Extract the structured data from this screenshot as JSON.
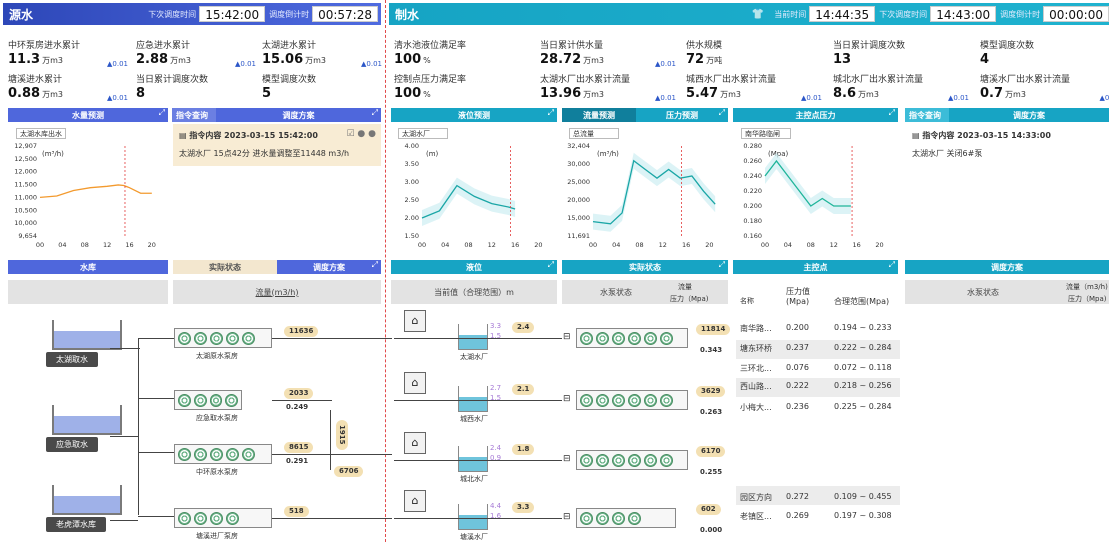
{
  "left_header": {
    "title": "源水",
    "next_label": "下次调度时间",
    "next_value": "15:42:00",
    "countdown_label": "调度倒计时",
    "countdown_value": "00:57:28"
  },
  "right_header": {
    "title": "制水",
    "current_label": "当前时间",
    "current_value": "14:44:35",
    "next_label": "下次调度时间",
    "next_value": "14:43:00",
    "countdown_label": "调度倒计时",
    "countdown_value": "00:00:00"
  },
  "left_stats": [
    {
      "label": "中环泵房进水累计",
      "value": "11.3",
      "unit": "万m3",
      "delta": "▲0.01"
    },
    {
      "label": "应急进水累计",
      "value": "2.88",
      "unit": "万m3",
      "delta": "▲0.01"
    },
    {
      "label": "太湖进水累计",
      "value": "15.06",
      "unit": "万m3",
      "delta": "▲0.01"
    },
    {
      "label": "塘溪进水累计",
      "value": "0.88",
      "unit": "万m3",
      "delta": "▲0.01"
    },
    {
      "label": "当日累计调度次数",
      "value": "8",
      "unit": "",
      "delta": ""
    },
    {
      "label": "模型调度次数",
      "value": "5",
      "unit": "",
      "delta": ""
    }
  ],
  "right_stats": [
    {
      "label": "清水池液位满足率",
      "value": "100",
      "unit": "%",
      "delta": ""
    },
    {
      "label": "当日累计供水量",
      "value": "28.72",
      "unit": "万m3",
      "delta": "▲0.01"
    },
    {
      "label": "供水规模",
      "value": "72",
      "unit": "万吨",
      "delta": ""
    },
    {
      "label": "当日累计调度次数",
      "value": "13",
      "unit": "",
      "delta": ""
    },
    {
      "label": "模型调度次数",
      "value": "4",
      "unit": "",
      "delta": ""
    },
    {
      "label": "控制点压力满足率",
      "value": "100",
      "unit": "%",
      "delta": ""
    },
    {
      "label": "太湖水厂出水累计流量",
      "value": "13.96",
      "unit": "万m3",
      "delta": "▲0.01"
    },
    {
      "label": "城西水厂出水累计流量",
      "value": "5.47",
      "unit": "万m3",
      "delta": "▲0.01"
    },
    {
      "label": "城北水厂出水累计流量",
      "value": "8.6",
      "unit": "万m3",
      "delta": "▲0.01"
    },
    {
      "label": "塘溪水厂出水累计流量",
      "value": "0.7",
      "unit": "万m3",
      "delta": "▲0.0"
    }
  ],
  "tabs": {
    "water_forecast": "水量预测",
    "cmd_query": "指令查询",
    "dispatch_plan": "调度方案",
    "level_forecast": "液位预测",
    "flow_forecast": "流量预测",
    "pressure_forecast": "压力预测",
    "main_pressure": "主控点压力",
    "cmd_query2": "指令查询",
    "dispatch_plan2": "调度方案"
  },
  "panels": {
    "water_select": "太湖水库出水",
    "water_unit": "(m³/h)",
    "level_select": "太湖水厂",
    "level_unit": "(m)",
    "flow_select": "总流量",
    "flow_unit": "(m³/h)",
    "pressure_select": "南华路临闸",
    "pressure_unit": "(Mpa)"
  },
  "commands": {
    "left_title": "指令内容 2023-03-15 15:42:00",
    "left_text": "太湖水厂 15点42分 进水量调整至11448 m3/h",
    "right_title": "指令内容 2023-03-15 14:33:00",
    "right_text": "太湖水厂 关闭6#泵"
  },
  "chart_data": [
    {
      "type": "line",
      "title": "",
      "xlabel": "",
      "ylabel": "(m³/h)",
      "x_ticks": [
        "00",
        "04",
        "08",
        "12",
        "16",
        "20"
      ],
      "y_ticks": [
        "12,907",
        "12,500",
        "12,000",
        "11,500",
        "11,000",
        "10,500",
        "10,000",
        "9,654"
      ],
      "ylim": [
        9654,
        12907
      ],
      "series": [
        {
          "values": [
            [
              0,
              11050
            ],
            [
              3,
              11100
            ],
            [
              6,
              11300
            ],
            [
              9,
              11400
            ],
            [
              12,
              11450
            ],
            [
              14,
              11500
            ],
            [
              15,
              11480
            ],
            [
              16,
              11400
            ],
            [
              18,
              11200
            ],
            [
              20,
              11200
            ]
          ]
        }
      ]
    },
    {
      "type": "line",
      "xlabel": "",
      "ylabel": "(m)",
      "x_ticks": [
        "00",
        "04",
        "08",
        "12",
        "16",
        "20"
      ],
      "y_ticks": [
        "4.00",
        "3.50",
        "3.00",
        "2.50",
        "2.00",
        "1.50"
      ],
      "ylim": [
        1.5,
        4.0
      ],
      "series": [
        {
          "values": [
            [
              0,
              2.0
            ],
            [
              3,
              2.2
            ],
            [
              6,
              2.9
            ],
            [
              9,
              2.6
            ],
            [
              12,
              2.4
            ],
            [
              15,
              2.3
            ],
            [
              16,
              2.25
            ]
          ]
        }
      ]
    },
    {
      "type": "line",
      "xlabel": "",
      "ylabel": "(m³/h)",
      "x_ticks": [
        "00",
        "04",
        "08",
        "12",
        "16",
        "20"
      ],
      "y_ticks": [
        "32,404",
        "30,000",
        "25,000",
        "20,000",
        "15,000",
        "11,691"
      ],
      "ylim": [
        11691,
        32404
      ],
      "series": [
        {
          "values": [
            [
              0,
              15000
            ],
            [
              3,
              14500
            ],
            [
              5,
              17000
            ],
            [
              7,
              29000
            ],
            [
              9,
              27000
            ],
            [
              11,
              25000
            ],
            [
              13,
              27000
            ],
            [
              15,
              25000
            ],
            [
              17,
              25500
            ],
            [
              19,
              22000
            ],
            [
              21,
              19000
            ]
          ]
        }
      ]
    },
    {
      "type": "line",
      "xlabel": "",
      "ylabel": "(Mpa)",
      "x_ticks": [
        "00",
        "04",
        "08",
        "12",
        "16",
        "20"
      ],
      "y_ticks": [
        "0.280",
        "0.260",
        "0.240",
        "0.220",
        "0.200",
        "0.180",
        "0.160"
      ],
      "ylim": [
        0.16,
        0.28
      ],
      "series": [
        {
          "values": [
            [
              0,
              0.24
            ],
            [
              2,
              0.26
            ],
            [
              4,
              0.24
            ],
            [
              6,
              0.22
            ],
            [
              8,
              0.2
            ],
            [
              10,
              0.21
            ],
            [
              12,
              0.2
            ],
            [
              14,
              0.2
            ],
            [
              15,
              0.2
            ]
          ]
        }
      ]
    }
  ],
  "lower_bars": {
    "reservoir": "水库",
    "actual_state": "实际状态",
    "dispatch_plan": "调度方案",
    "level": "液位",
    "actual_state2": "实际状态",
    "main_control": "主控点",
    "dispatch_plan3": "调度方案"
  },
  "col_headers": {
    "flow": "流量(m3/h)",
    "level": "当前值（合理范围）m",
    "pump_state": "水泵状态",
    "flow2": "流量",
    "pressure2": "压力（Mpa)",
    "name": "名称",
    "pressure_value": "压力值 (Mpa)",
    "range": "合理范围(Mpa)",
    "pump_state2": "水泵状态",
    "flow3": "流量（m3/h)",
    "pressure3": "压力（Mpa)"
  },
  "reservoirs": [
    "太湖取水",
    "应急取水",
    "老虎潭水库"
  ],
  "pump_rooms": [
    {
      "name": "太湖原水泵房",
      "flow": "11636",
      "pressure": ""
    },
    {
      "name": "应急取水泵房",
      "flow": "2033",
      "pressure": "0.249"
    },
    {
      "name": "中环原水泵房",
      "flow": "8615",
      "pressure": "0.291"
    },
    {
      "name": "塘溪进厂泵房",
      "flow": "518",
      "pressure": ""
    }
  ],
  "link_values": {
    "vertical": "1915",
    "lower": "6706"
  },
  "plants": [
    {
      "name": "太湖水厂",
      "level": "2.4",
      "hi": "3.3",
      "lo": "1.5",
      "out_flow": "11814",
      "out_pressure": "0.343"
    },
    {
      "name": "城西水厂",
      "level": "2.1",
      "hi": "2.7",
      "lo": "1.5",
      "out_flow": "3629",
      "out_pressure": "0.263"
    },
    {
      "name": "城北水厂",
      "level": "1.8",
      "hi": "2.4",
      "lo": "0.9",
      "out_flow": "6170",
      "out_pressure": "0.255"
    },
    {
      "name": "塘溪水厂",
      "level": "3.3",
      "hi": "4.4",
      "lo": "1.6",
      "out_flow": "602",
      "out_pressure": "0.000"
    }
  ],
  "control_points": [
    {
      "name": "南华路...",
      "value": "0.200",
      "range": "0.194 ~ 0.233"
    },
    {
      "name": "塘东环桥",
      "value": "0.237",
      "range": "0.222 ~ 0.284"
    },
    {
      "name": "三环北...",
      "value": "0.076",
      "range": "0.072 ~ 0.118"
    },
    {
      "name": "西山路...",
      "value": "0.222",
      "range": "0.218 ~ 0.256"
    },
    {
      "name": "小梅大...",
      "value": "0.236",
      "range": "0.225 ~ 0.284"
    },
    {
      "name": "园区方向",
      "value": "0.272",
      "range": "0.109 ~ 0.455"
    },
    {
      "name": "老镇区...",
      "value": "0.269",
      "range": "0.197 ~ 0.308"
    }
  ]
}
